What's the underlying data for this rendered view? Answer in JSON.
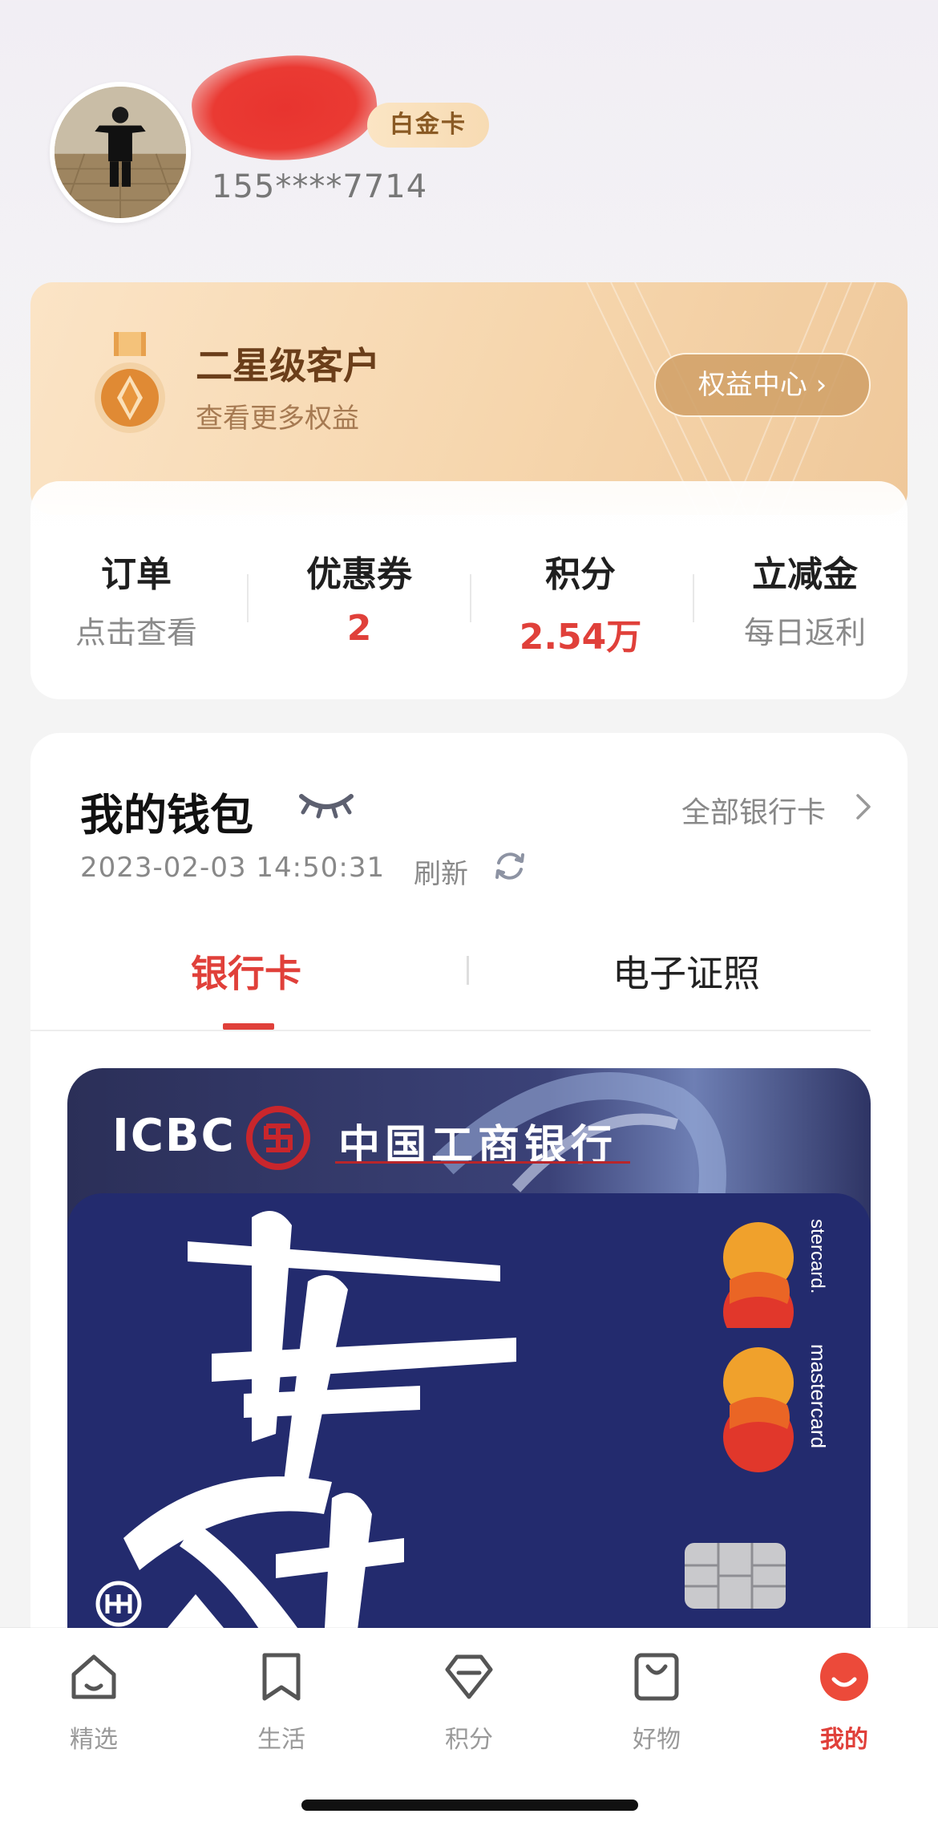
{
  "profile": {
    "tier_badge": "白金卡",
    "phone": "155****7714"
  },
  "member": {
    "title": "二星级客户",
    "subtitle": "查看更多权益",
    "rights_button": "权益中心 ›"
  },
  "stats": [
    {
      "title": "订单",
      "value": "点击查看"
    },
    {
      "title": "优惠券",
      "value": "2"
    },
    {
      "title": "积分",
      "value": "2.54万"
    },
    {
      "title": "立减金",
      "value": "每日返利"
    }
  ],
  "wallet": {
    "title": "我的钱包",
    "all_cards": "全部银行卡",
    "timestamp": "2023-02-03 14:50:31",
    "refresh": "刷新",
    "tabs": [
      "银行卡",
      "电子证照"
    ]
  },
  "card": {
    "brand_en": "ICBC",
    "brand_cn": "中国工商银行",
    "network": "mastercard",
    "network_partial": "stercard."
  },
  "nav": [
    {
      "label": "精选",
      "icon": "home-icon"
    },
    {
      "label": "生活",
      "icon": "bookmark-icon"
    },
    {
      "label": "积分",
      "icon": "diamond-icon"
    },
    {
      "label": "好物",
      "icon": "shopping-bag-icon"
    },
    {
      "label": "我的",
      "icon": "smiley-icon"
    }
  ],
  "colors": {
    "accent": "#e0403a",
    "gold_text": "#6b3e1a",
    "card_blue": "#232b6e"
  }
}
